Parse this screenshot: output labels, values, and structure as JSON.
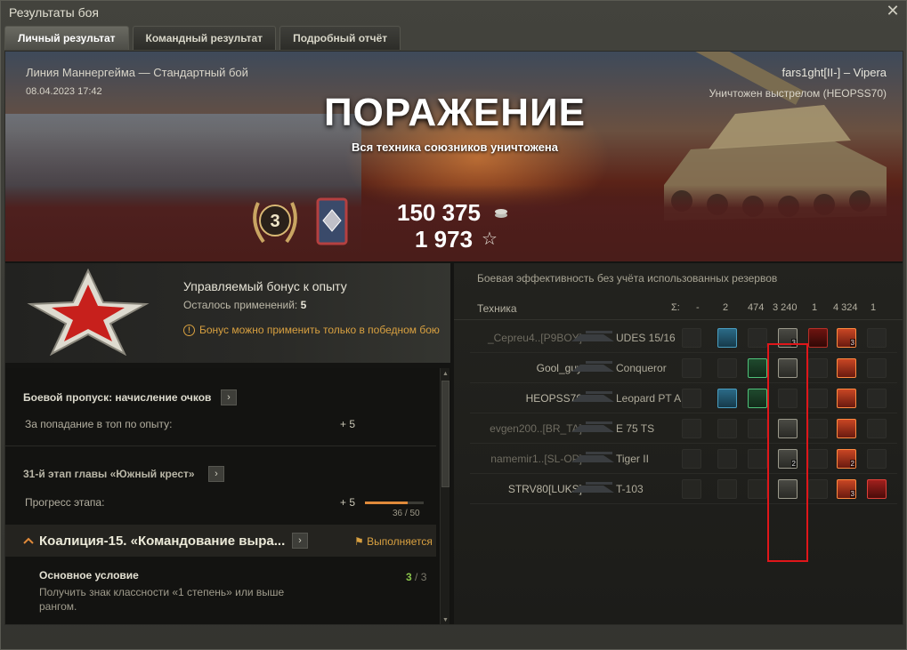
{
  "window": {
    "title": "Результаты боя"
  },
  "tabs": [
    {
      "label": "Личный результат",
      "active": true
    },
    {
      "label": "Командный результат",
      "active": false
    },
    {
      "label": "Подробный отчёт",
      "active": false
    }
  ],
  "banner": {
    "map_mode": "Линия Маннергейма — Стандартный бой",
    "datetime": "08.04.2023 17:42",
    "player": "fars1ght[II-] – Vipera",
    "death_info": "Уничтожен выстрелом (HEOPSS70)",
    "result": "ПОРАЖЕНИЕ",
    "result_reason": "Вся техника союзников уничтожена",
    "class_badge": "3",
    "credits": "150 375",
    "xp": "1 973"
  },
  "bonus": {
    "title": "Управляемый бонус к опыту",
    "remaining_label": "Осталось применений:",
    "remaining_value": "5",
    "warning": "Бонус можно применить только в победном бою"
  },
  "quests": {
    "battle_pass": {
      "title": "Боевой пропуск: начисление очков",
      "row_label": "За попадание в топ по опыту:",
      "row_value": "+ 5"
    },
    "stage": {
      "title": "31-й этап главы «Южный крест»",
      "row_label": "Прогресс этапа:",
      "row_value": "+ 5",
      "progress_text": "36 / 50",
      "progress": 0.72
    },
    "coalition": {
      "title": "Коалиция-15. «Командование выра...",
      "status": "Выполняется",
      "condition_title": "Основное условие",
      "condition_desc": "Получить знак классности «1 степень» или выше рангом.",
      "condition_done": "3",
      "condition_sep": " / ",
      "condition_total": "3"
    }
  },
  "efficiency": {
    "title": "Боевая эффективность без учёта использованных резервов",
    "header": {
      "tech": "Техника",
      "sigma": "Σ:",
      "c1": "-",
      "c2": "2",
      "c3": "474",
      "c4": "3 240",
      "c5": "1",
      "c6": "4 324",
      "c7": "1"
    },
    "rows": [
      {
        "player": "_Cepreu4..[P9BOY]",
        "tank": "UDES 15/16"
      },
      {
        "player": "Gool_guy",
        "tank": "Conqueror"
      },
      {
        "player": "HEOPSS70",
        "tank": "Leopard PT A"
      },
      {
        "player": "evgen200..[BR_TA]",
        "tank": "E 75 TS"
      },
      {
        "player": "namemir1..[SL-OP]",
        "tank": "Tiger II"
      },
      {
        "player": "STRV80[LUKS]",
        "tank": "T-103"
      }
    ],
    "icon_counts": {
      "r0_block": "3",
      "r0_dmg": "3",
      "r4_block": "2",
      "r4_dmg": "2",
      "r5_dmg": "3"
    },
    "colors": {
      "highlight": "#e0161a",
      "accent_orange": "#d8a040",
      "progress_green": "#89c34a"
    }
  }
}
